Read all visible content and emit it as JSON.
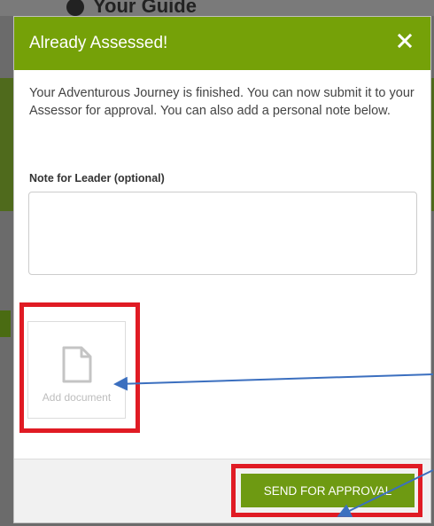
{
  "background": {
    "heading_fragment": "Your Guide"
  },
  "modal": {
    "title": "Already Assessed!",
    "close_icon": "close-icon",
    "message": "Your Adventurous Journey is finished. You can now submit it to your Assessor for approval. You can also add a personal note below.",
    "note_label": "Note for Leader (optional)",
    "note_value": "",
    "add_document_label": "Add document",
    "add_document_icon": "document-icon",
    "submit_label": "SEND FOR APPROVAL"
  },
  "colors": {
    "header_green": "#75a108",
    "button_green": "#6e9a12",
    "annotation_red": "#e01b24",
    "arrow_blue": "#3b6fbf"
  }
}
